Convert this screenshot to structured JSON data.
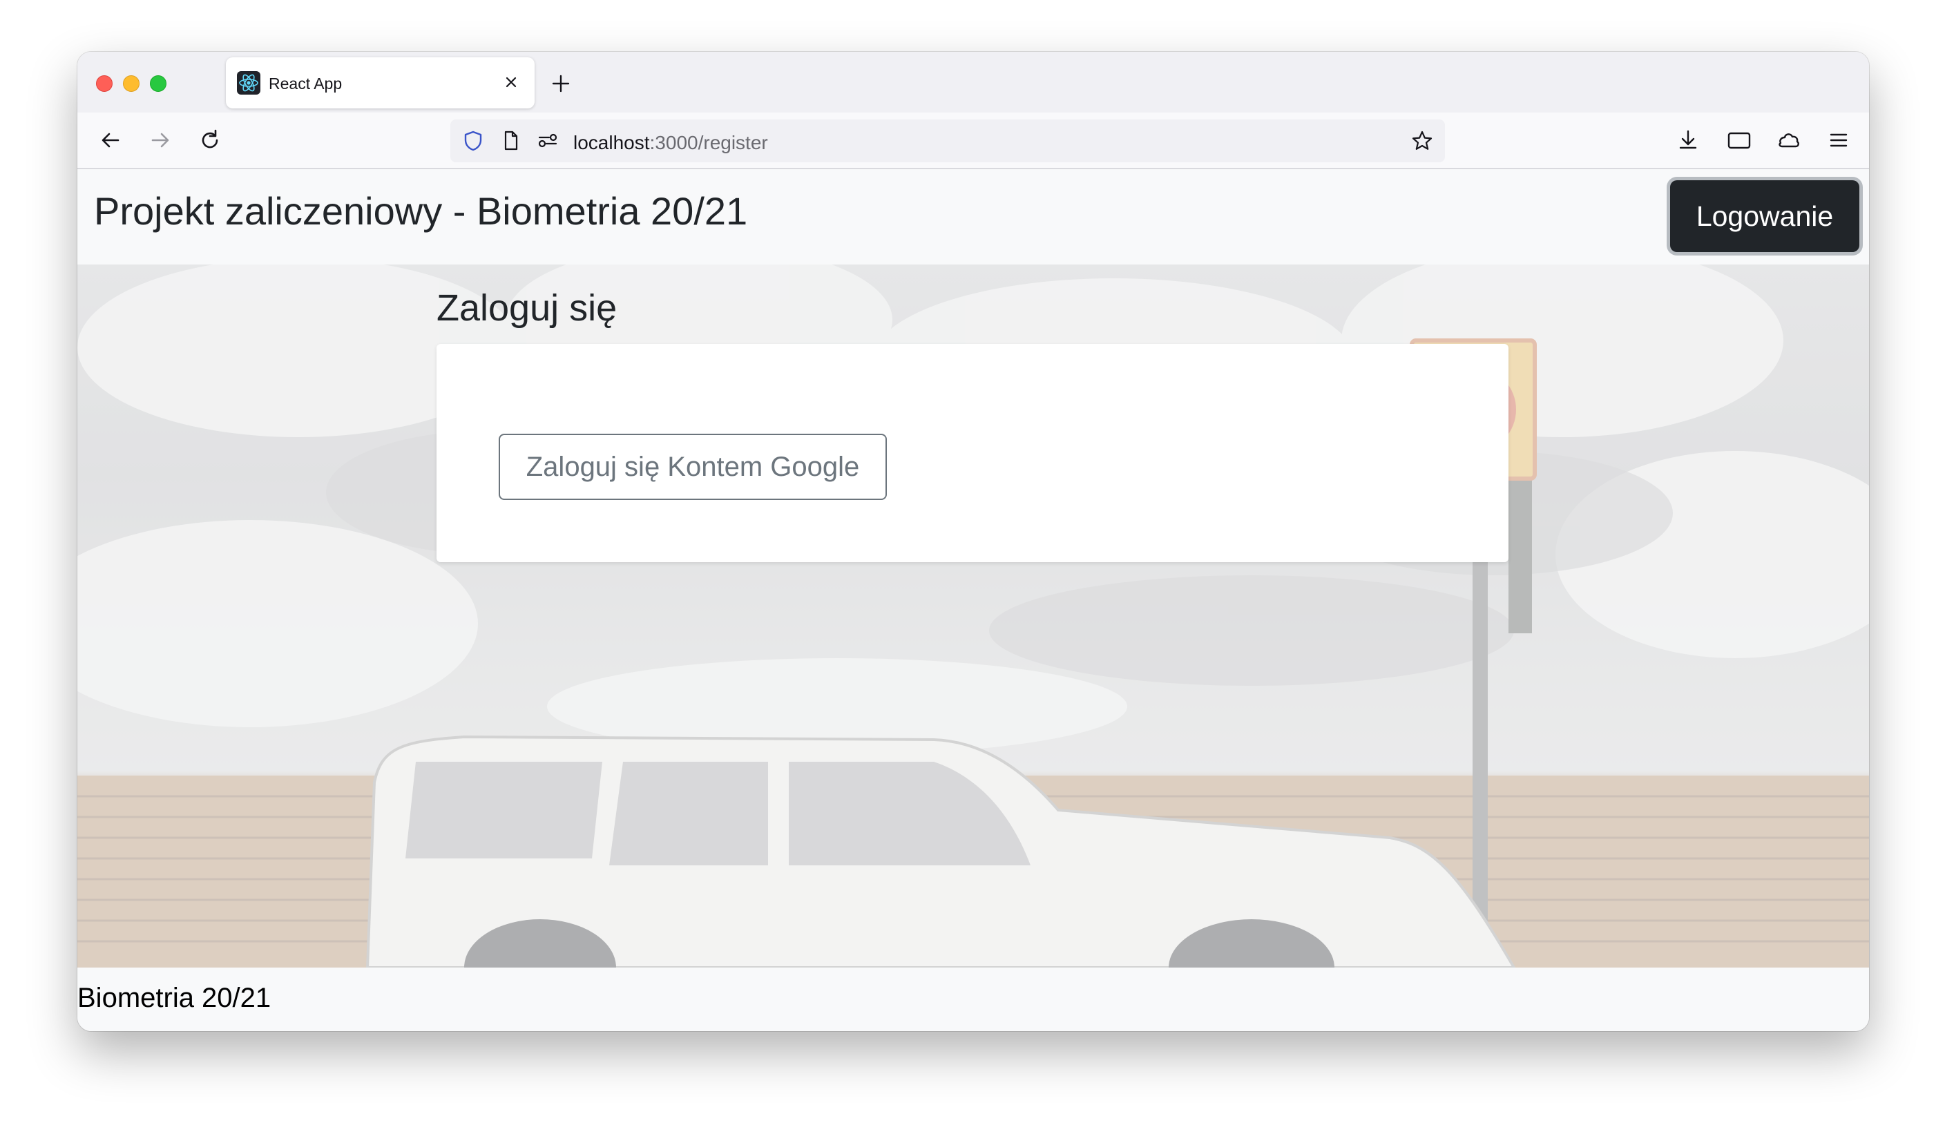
{
  "browser": {
    "tab": {
      "title": "React App",
      "favicon": "react-logo-icon"
    },
    "url": {
      "host": "localhost",
      "rest": ":3000/register"
    },
    "icons": {
      "back": "arrow-left-icon",
      "forward": "arrow-right-icon",
      "reload": "reload-icon",
      "tracking": "shield-icon",
      "page": "document-icon",
      "permissions": "permissions-icon",
      "bookmark": "star-icon",
      "downloads": "download-icon",
      "sidebar": "sidebar-icon",
      "account": "cloud-icon",
      "menu": "hamburger-menu-icon"
    }
  },
  "header": {
    "brand": "Projekt zaliczeniowy - Biometria 20/21",
    "login_button": "Logowanie"
  },
  "main": {
    "title": "Zaloguj się",
    "google_button": "Zaloguj się Kontem Google"
  },
  "footer": {
    "text": "Biometria 20/21"
  },
  "colors": {
    "header_bg": "#f8f9fa",
    "dark_button": "#212529",
    "outline_secondary": "#6c757d"
  }
}
